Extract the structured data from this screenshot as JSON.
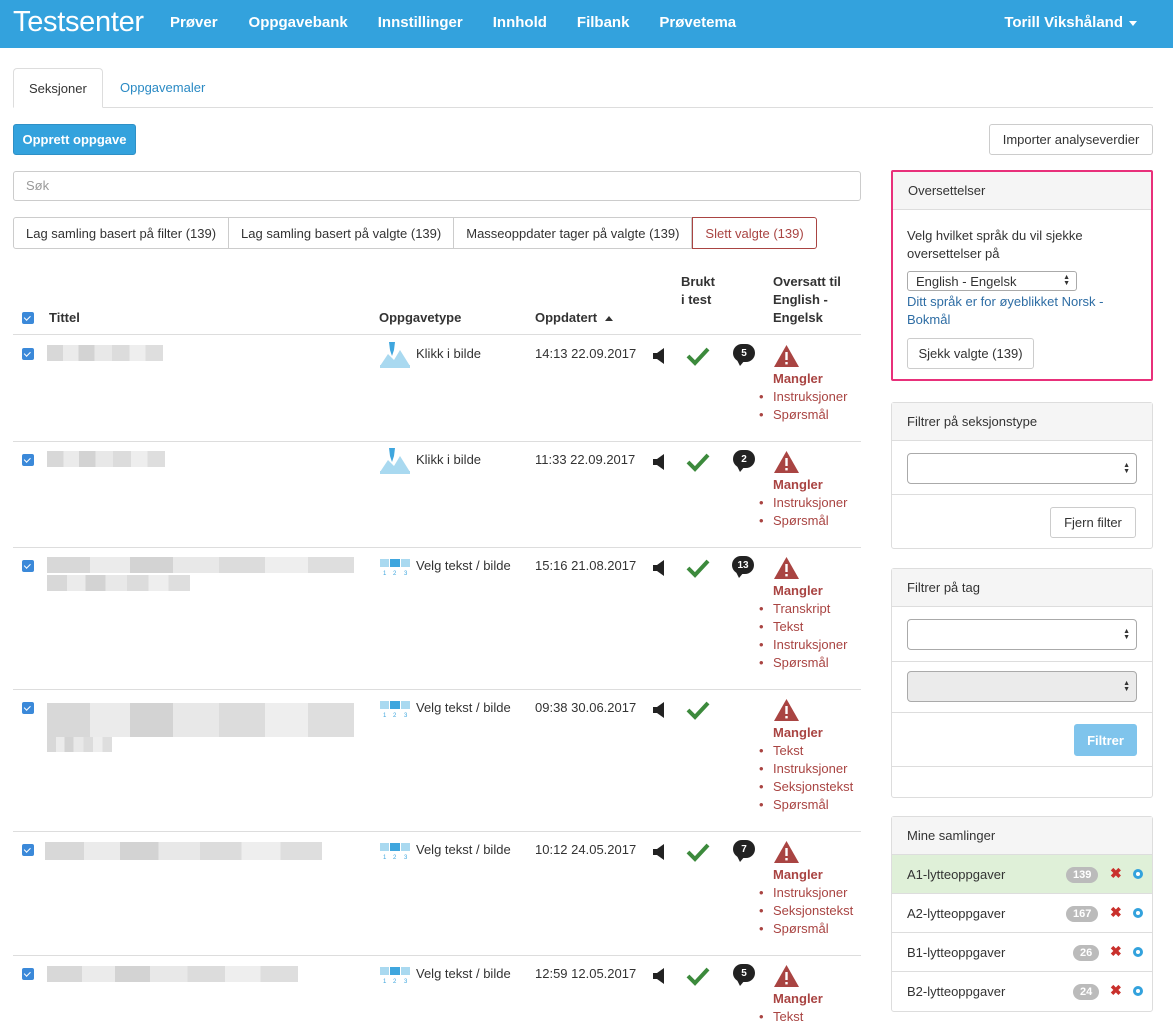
{
  "navbar": {
    "brand": "Testsenter",
    "items": [
      "Prøver",
      "Oppgavebank",
      "Innstillinger",
      "Innhold",
      "Filbank",
      "Prøvetema"
    ],
    "user": "Torill Vikshåland"
  },
  "tabs": [
    "Seksjoner",
    "Oppgavemaler"
  ],
  "toolbar": {
    "create": "Opprett oppgave",
    "import": "Importer analyseverdier",
    "search_placeholder": "Søk"
  },
  "bulk_buttons": [
    "Lag samling basert på filter (139)",
    "Lag samling basert på valgte (139)",
    "Masseoppdater tager på valgte (139)",
    "Slett valgte (139)"
  ],
  "table": {
    "headers": {
      "title": "Tittel",
      "type": "Oppgavetype",
      "updated": "Oppdatert",
      "used1": "Brukt",
      "used2": "i test",
      "trans1": "Oversatt til",
      "trans2": "English -",
      "trans3": "Engelsk"
    },
    "missing_label": "Mangler",
    "rows": [
      {
        "type": "Klikk i bilde",
        "updated": "14:13 22.09.2017",
        "comments": "5",
        "missing": [
          "Instruksjoner",
          "Spørsmål"
        ]
      },
      {
        "type": "Klikk i bilde",
        "updated": "11:33 22.09.2017",
        "comments": "2",
        "missing": [
          "Instruksjoner",
          "Spørsmål"
        ]
      },
      {
        "type": "Velg tekst / bilde",
        "updated": "15:16 21.08.2017",
        "comments": "13",
        "missing": [
          "Transkript",
          "Tekst",
          "Instruksjoner",
          "Spørsmål"
        ]
      },
      {
        "type": "Velg tekst / bilde",
        "updated": "09:38 30.06.2017",
        "comments": "",
        "missing": [
          "Tekst",
          "Instruksjoner",
          "Seksjonstekst",
          "Spørsmål"
        ]
      },
      {
        "type": "Velg tekst / bilde",
        "updated": "10:12 24.05.2017",
        "comments": "7",
        "missing": [
          "Instruksjoner",
          "Seksjonstekst",
          "Spørsmål"
        ]
      },
      {
        "type": "Velg tekst / bilde",
        "updated": "12:59 12.05.2017",
        "comments": "5",
        "missing": [
          "Tekst"
        ]
      }
    ]
  },
  "translations_panel": {
    "title": "Oversettelser",
    "desc": "Velg hvilket språk du vil sjekke oversettelser på",
    "selected": "English - Engelsk",
    "note": "Ditt språk er for øyeblikket Norsk - Bokmål",
    "check": "Sjekk valgte (139)"
  },
  "filter_section": {
    "title": "Filtrer på seksjonstype",
    "clear": "Fjern filter"
  },
  "filter_tag": {
    "title": "Filtrer på tag",
    "button": "Filtrer"
  },
  "collections": {
    "title": "Mine samlinger",
    "items": [
      {
        "name": "A1-lytteoppgaver",
        "count": "139"
      },
      {
        "name": "A2-lytteoppgaver",
        "count": "167"
      },
      {
        "name": "B1-lytteoppgaver",
        "count": "26"
      },
      {
        "name": "B2-lytteoppgaver",
        "count": "24"
      }
    ]
  },
  "colors": {
    "brand": "#33a2dd",
    "danger": "#a94442",
    "success": "#3c8a3c",
    "highlight": "#e8307a"
  }
}
